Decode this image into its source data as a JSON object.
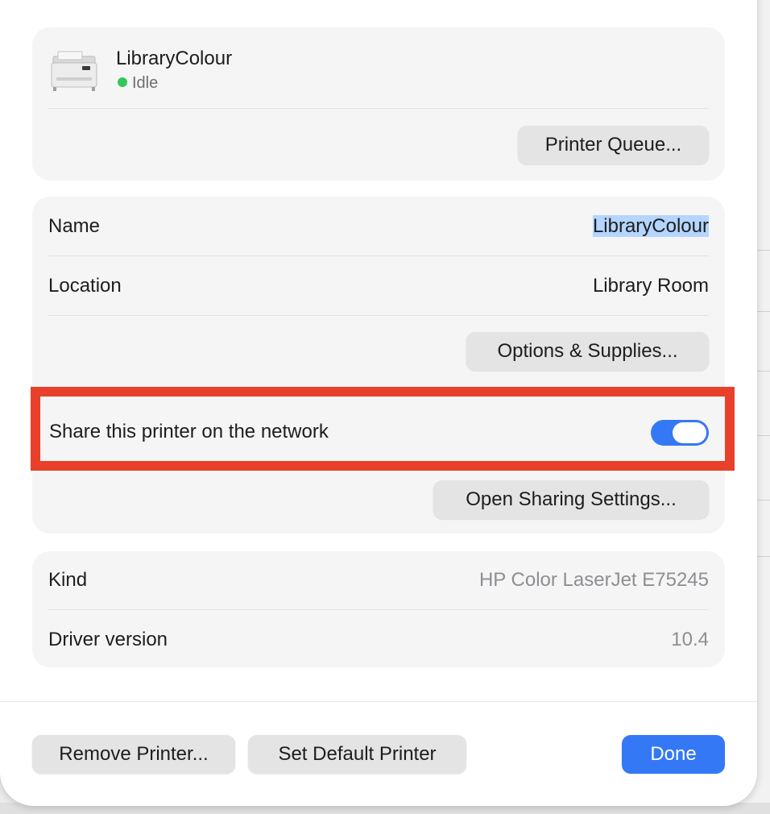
{
  "printer": {
    "name": "LibraryColour",
    "status": "Idle",
    "status_color": "#34c759",
    "icon": "printer-icon",
    "queue_button": "Printer Queue..."
  },
  "details": {
    "name_label": "Name",
    "name_value": "LibraryColour",
    "location_label": "Location",
    "location_value": "Library Room",
    "options_button": "Options & Supplies..."
  },
  "sharing": {
    "share_label": "Share this printer on the network",
    "share_enabled": true,
    "sharing_settings_button": "Open Sharing Settings..."
  },
  "info": {
    "kind_label": "Kind",
    "kind_value": "HP Color LaserJet E75245",
    "driver_label": "Driver version",
    "driver_value": "10.4"
  },
  "footer": {
    "remove_button": "Remove Printer...",
    "default_button": "Set Default Printer",
    "done_button": "Done"
  },
  "colors": {
    "accent": "#3478f6",
    "annotation": "#e8402b"
  }
}
